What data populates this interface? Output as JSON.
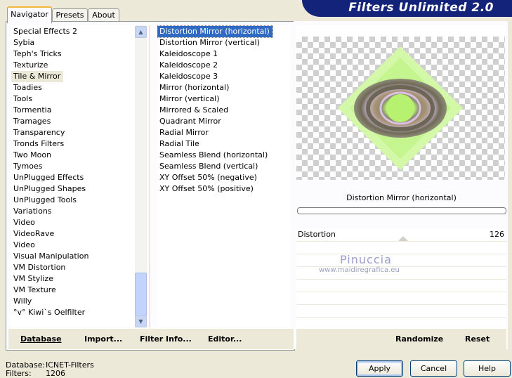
{
  "app": {
    "title": "Filters Unlimited 2.0"
  },
  "tabs": [
    {
      "label": "Navigator",
      "active": true
    },
    {
      "label": "Presets",
      "active": false
    },
    {
      "label": "About",
      "active": false
    }
  ],
  "categories": {
    "items": [
      "Special Effects 2",
      "Sybia",
      "Teph's Tricks",
      "Texturize",
      "Tile & Mirror",
      "Toadies",
      "Tools",
      "Tormentia",
      "Tramages",
      "Transparency",
      "Tronds Filters",
      "Two Moon",
      "Tymoes",
      "UnPlugged Effects",
      "UnPlugged Shapes",
      "UnPlugged Tools",
      "Variations",
      "Video",
      "VideoRave",
      "Video",
      "Visual Manipulation",
      "VM Distortion",
      "VM Stylize",
      "VM Texture",
      "Willy",
      "°v° Kiwi`s Oelfilter"
    ],
    "selected_index": 4
  },
  "filters": {
    "items": [
      "Distortion Mirror (horizontal)",
      "Distortion Mirror (vertical)",
      "Kaleidoscope 1",
      "Kaleidoscope 2",
      "Kaleidoscope 3",
      "Mirror (horizontal)",
      "Mirror (vertical)",
      "Mirrored & Scaled",
      "Quadrant Mirror",
      "Radial Mirror",
      "Radial Tile",
      "Seamless Blend (horizontal)",
      "Seamless Blend (vertical)",
      "XY Offset 50% (negative)",
      "XY Offset 50% (positive)"
    ],
    "selected_index": 0
  },
  "left_buttons": {
    "database": "Database",
    "import": "Import...",
    "filter_info": "Filter Info...",
    "editor": "Editor..."
  },
  "preview": {
    "filter_name": "Distortion Mirror (horizontal)",
    "progress": 0
  },
  "parameters": [
    {
      "label": "Distortion",
      "value": "126"
    }
  ],
  "watermark": {
    "name": "Pinuccia",
    "url": "www.maidiregrafica.eu"
  },
  "right_buttons": {
    "randomize": "Randomize",
    "reset": "Reset"
  },
  "status": {
    "database_label": "Database:",
    "database_value": "ICNET-Filters",
    "filters_label": "Filters:",
    "filters_value": "1206"
  },
  "dialog_buttons": {
    "apply": "Apply",
    "cancel": "Cancel",
    "help": "Help"
  },
  "colors": {
    "selection_blue": "#316ac5",
    "banner": "#14237a",
    "preview_green": "#b8f47c"
  }
}
